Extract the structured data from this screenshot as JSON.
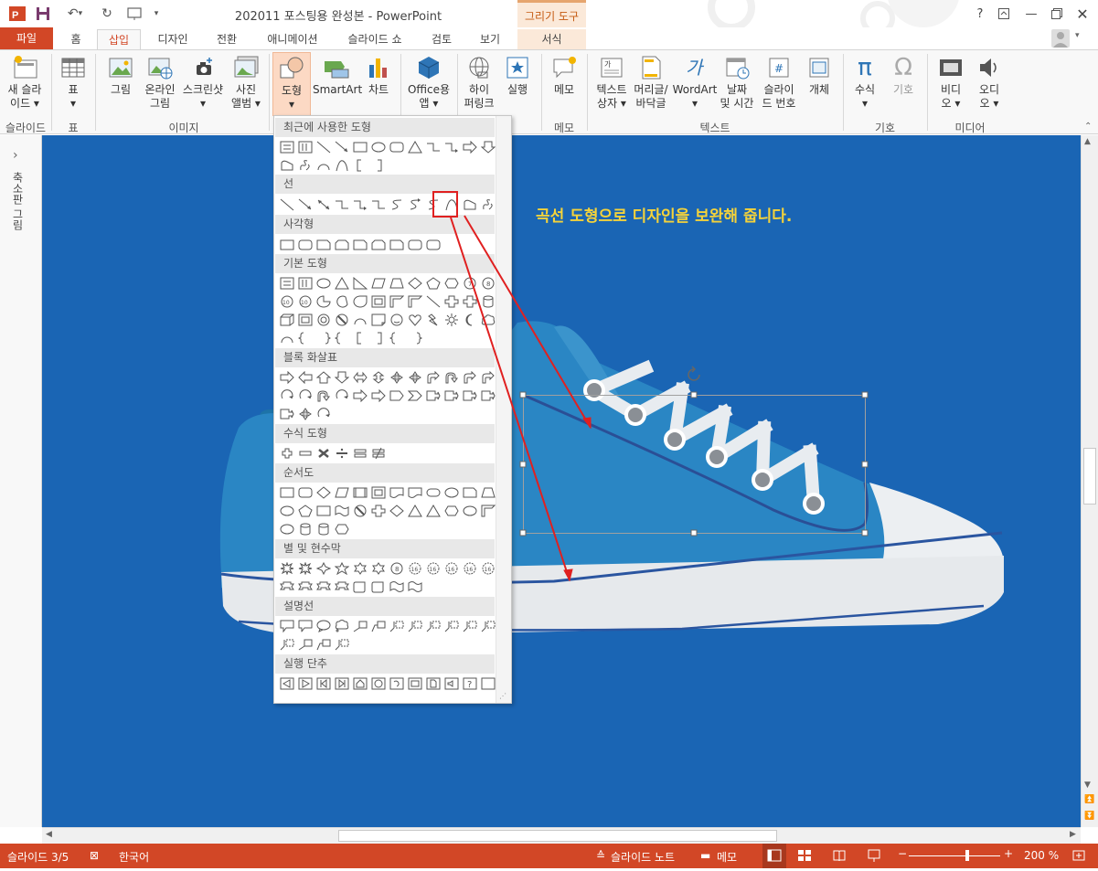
{
  "app": {
    "doc_title": "202011 포스팅용 완성본 - PowerPoint",
    "context_tab_title": "그리기 도구",
    "help": "?"
  },
  "tabs": [
    {
      "label": "파일",
      "name": "tab-file"
    },
    {
      "label": "홈",
      "name": "tab-home"
    },
    {
      "label": "삽입",
      "name": "tab-insert"
    },
    {
      "label": "디자인",
      "name": "tab-design"
    },
    {
      "label": "전환",
      "name": "tab-transitions"
    },
    {
      "label": "애니메이션",
      "name": "tab-animations"
    },
    {
      "label": "슬라이드 쇼",
      "name": "tab-slideshow"
    },
    {
      "label": "검토",
      "name": "tab-review"
    },
    {
      "label": "보기",
      "name": "tab-view"
    },
    {
      "label": "서식",
      "name": "tab-format"
    }
  ],
  "ribbon": {
    "new_slide": [
      "새 슬라",
      "이드 ▾"
    ],
    "table": [
      "표",
      "▾"
    ],
    "picture": "그림",
    "online_picture": [
      "온라인",
      "그림"
    ],
    "screenshot": [
      "스크린샷",
      "▾"
    ],
    "photo_album": [
      "사진",
      "앨범 ▾"
    ],
    "shapes": [
      "도형",
      "▾"
    ],
    "smartart": "SmartArt",
    "chart": "차트",
    "office_apps": [
      "Office용",
      "앱 ▾"
    ],
    "hyperlink": [
      "하이",
      "퍼링크"
    ],
    "action": "실행",
    "comment": "메모",
    "textbox": [
      "텍스트",
      "상자 ▾"
    ],
    "header_footer": [
      "머리글/",
      "바닥글"
    ],
    "wordart": [
      "WordArt",
      "▾"
    ],
    "date_time": [
      "날짜",
      "및 시간"
    ],
    "slide_number": [
      "슬라이",
      "드 번호"
    ],
    "object": "개체",
    "equation": [
      "수식",
      "▾"
    ],
    "symbol": "기호",
    "video": [
      "비디",
      "오 ▾"
    ],
    "audio": [
      "오디",
      "오 ▾"
    ],
    "groups": {
      "slides": "슬라이드",
      "tables": "표",
      "images": "이미지",
      "comments": "메모",
      "text": "텍스트",
      "symbols": "기호",
      "media": "미디어"
    }
  },
  "left_pane": {
    "label": "축소판 그림",
    "arrow": "›"
  },
  "slide": {
    "caption": "곡선 도형으로 디자인을 보완해 줍니다.",
    "colors": {
      "background": "#1a65b4",
      "caption": "#f5d33a",
      "shoe": "#2a86c4"
    }
  },
  "shapes_menu": {
    "sections": [
      {
        "title": "최근에 사용한 도형"
      },
      {
        "title": "선"
      },
      {
        "title": "사각형"
      },
      {
        "title": "기본 도형"
      },
      {
        "title": "블록 화살표"
      },
      {
        "title": "수식 도형"
      },
      {
        "title": "순서도"
      },
      {
        "title": "별 및 현수막"
      },
      {
        "title": "설명선"
      },
      {
        "title": "실행 단추"
      }
    ],
    "selected_tool": "curve"
  },
  "status": {
    "slide_info": "슬라이드 3/5",
    "language": "한국어",
    "notes": "슬라이드 노트",
    "comments": "메모",
    "zoom": "200 %"
  }
}
